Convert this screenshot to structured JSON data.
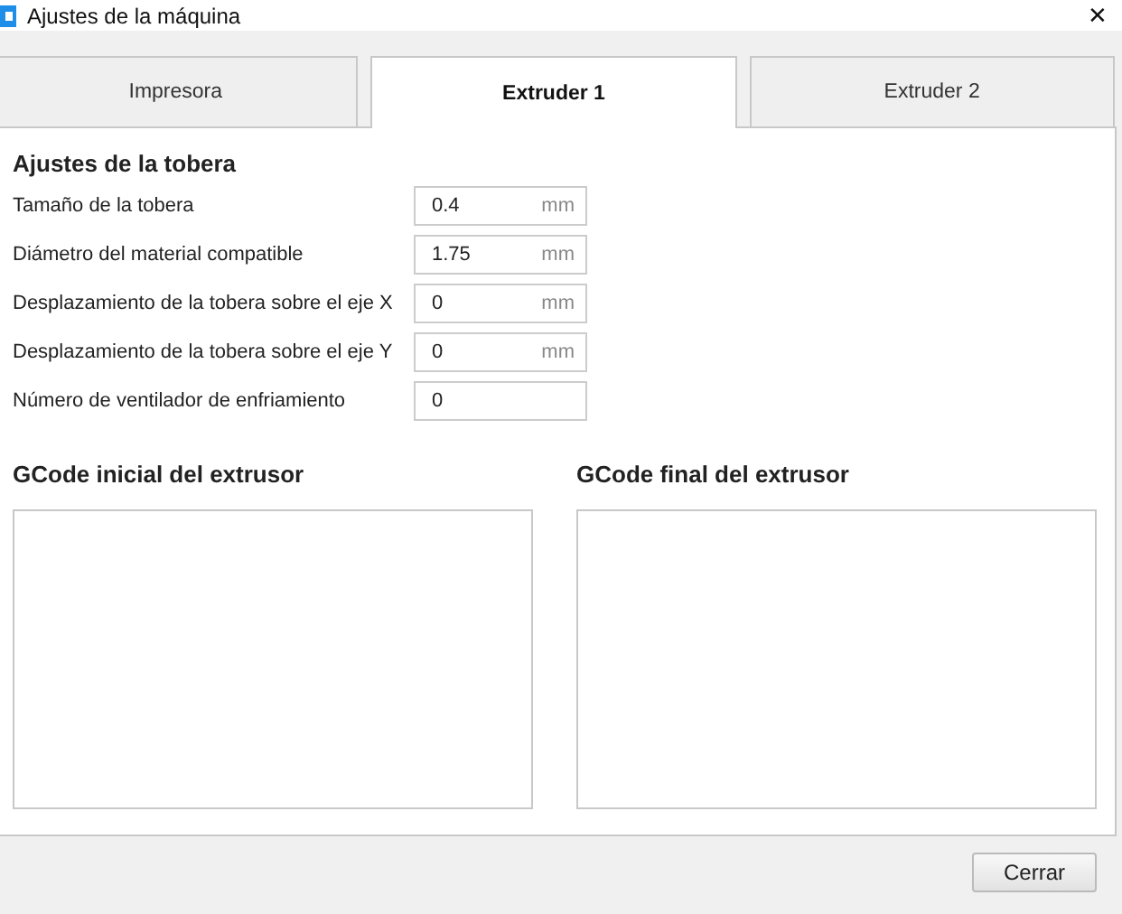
{
  "window": {
    "title": "Ajustes de la máquina",
    "close": "✕"
  },
  "tabs": [
    {
      "label": "Impresora",
      "selected": false
    },
    {
      "label": "Extruder 1",
      "selected": true
    },
    {
      "label": "Extruder 2",
      "selected": false
    }
  ],
  "section_title": "Ajustes de la tobera",
  "settings": [
    {
      "label": "Tamaño de la tobera",
      "value": "0.4",
      "unit": "mm"
    },
    {
      "label": "Diámetro del material compatible",
      "value": "1.75",
      "unit": "mm"
    },
    {
      "label": "Desplazamiento de la tobera sobre el eje X",
      "value": "0",
      "unit": "mm"
    },
    {
      "label": "Desplazamiento de la tobera sobre el eje Y",
      "value": "0",
      "unit": "mm"
    },
    {
      "label": "Número de ventilador de enfriamiento",
      "value": "0"
    }
  ],
  "gcode": [
    {
      "title": "GCode inicial del extrusor"
    },
    {
      "title": "GCode final del extrusor"
    }
  ],
  "buttons": [
    "Cerrar"
  ]
}
